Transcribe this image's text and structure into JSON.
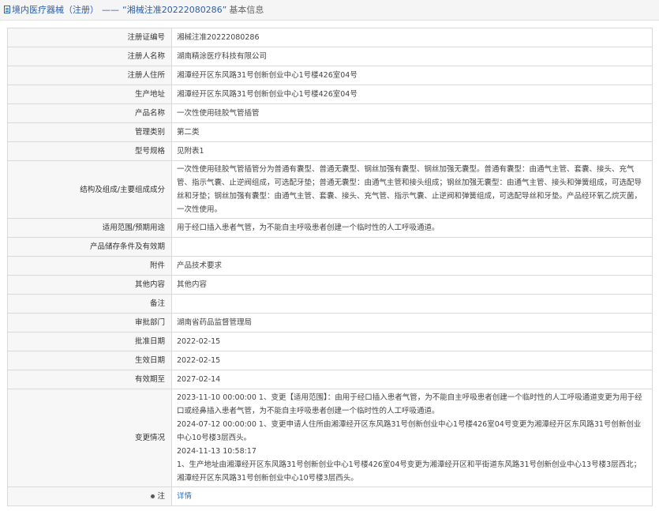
{
  "header": {
    "category": "境内医疗器械（注册）",
    "separator": "——",
    "reg_quoted": "“湘械注准20222080286”",
    "suffix": "基本信息"
  },
  "rows": [
    {
      "label": "注册证编号",
      "value": "湘械注准20222080286"
    },
    {
      "label": "注册人名称",
      "value": "湖南精涂医疗科技有限公司"
    },
    {
      "label": "注册人住所",
      "value": "湘潭经开区东风路31号创新创业中心1号楼426室04号"
    },
    {
      "label": "生产地址",
      "value": "湘潭经开区东风路31号创新创业中心1号楼426室04号"
    },
    {
      "label": "产品名称",
      "value": "一次性使用硅胶气管插管"
    },
    {
      "label": "管理类别",
      "value": "第二类"
    },
    {
      "label": "型号规格",
      "value": "见附表1"
    },
    {
      "label": "结构及组成/主要组成成分",
      "value": "一次性使用硅胶气管插管分为普通有囊型、普通无囊型、钢丝加强有囊型、钢丝加强无囊型。普通有囊型：由通气主管、套囊、接头、充气管、指示气囊、止逆阀组成，可选配牙垫；普通无囊型：由通气主管和接头组成；钢丝加强无囊型：由通气主管、接头和弹簧组成，可选配导丝和牙垫；钢丝加强有囊型：由通气主管、套囊、接头、充气管、指示气囊、止逆阀和弹簧组成，可选配导丝和牙垫。产品经环氧乙烷灭菌，一次性使用。"
    },
    {
      "label": "适用范围/预期用途",
      "value": "用于经口插入患者气管，为不能自主呼吸患者创建一个临时性的人工呼吸通道。"
    },
    {
      "label": "产品储存条件及有效期",
      "value": ""
    },
    {
      "label": "附件",
      "value": "产品技术要求"
    },
    {
      "label": "其他内容",
      "value": "其他内容"
    },
    {
      "label": "备注",
      "value": ""
    },
    {
      "label": "审批部门",
      "value": "湖南省药品监督管理局"
    },
    {
      "label": "批准日期",
      "value": "2022-02-15"
    },
    {
      "label": "生效日期",
      "value": "2022-02-15"
    },
    {
      "label": "有效期至",
      "value": "2027-02-14"
    }
  ],
  "changes": {
    "label": "变更情况",
    "lines": [
      "2023-11-10 00:00:00 1、变更【适用范围】：由用于经口插入患者气管，为不能自主呼吸患者创建一个临时性的人工呼吸通道变更为用于经口或经鼻插入患者气管，为不能自主呼吸患者创建一个临时性的人工呼吸通道。",
      "2024-07-12 00:00:00 1、变更申请人住所由湘潭经开区东风路31号创新创业中心1号楼426室04号变更为湘潭经开区东风路31号创新创业中心10号楼3层西头。",
      "2024-11-13 10:58:17",
      "1、生产地址由湘潭经开区东风路31号创新创业中心1号楼426室04号变更为湘潭经开区和平街道东风路31号创新创业中心13号楼3层西北；湘潭经开区东风路31号创新创业中心10号楼3层西头。"
    ]
  },
  "footer": {
    "label": "注",
    "icon": "gear-icon",
    "link": "详情"
  },
  "colors": {
    "accent": "#2b5fa8",
    "link": "#2b6fc2",
    "label_bg": "#f7f7f7",
    "border": "#d9d9d9"
  }
}
